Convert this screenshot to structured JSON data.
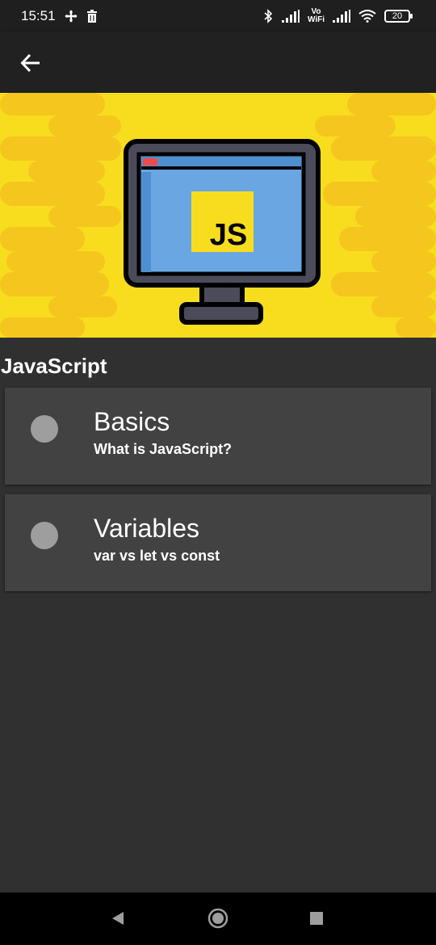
{
  "status_bar": {
    "time": "15:51",
    "left_icons": [
      "fan-icon",
      "trash-icon"
    ],
    "vowifi_line1": "Vo",
    "vowifi_line2": "WiFi",
    "battery_level": "20"
  },
  "app_bar": {
    "back_icon": "arrow-left-icon"
  },
  "banner": {
    "badge_text": "JS",
    "colors": {
      "background": "#f7dd1e",
      "stripe": "#f5c61d",
      "monitor_frame": "#3d3d4a",
      "screen": "#6aa7e2",
      "badge": "#f7dd1e"
    }
  },
  "page": {
    "title": "JavaScript"
  },
  "topics": [
    {
      "title": "Basics",
      "subtitle": "What is JavaScript?"
    },
    {
      "title": "Variables",
      "subtitle": "var vs let vs const"
    }
  ],
  "nav_bar": {
    "buttons": [
      "back-triangle-icon",
      "home-circle-icon",
      "recents-square-icon"
    ]
  }
}
